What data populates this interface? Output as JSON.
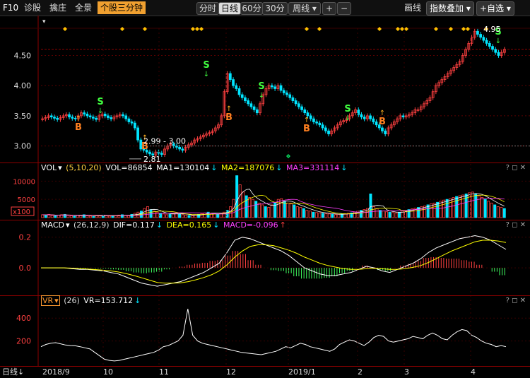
{
  "toolbar": {
    "f10": "F10",
    "diagnose": "诊股",
    "xiangqing": "擒庄",
    "quanjing": "全景",
    "mode": "个股三分钟",
    "periods": [
      "分时",
      "日线",
      "60分",
      "30分"
    ],
    "week_dd": "周线",
    "plus": "+",
    "minus": "−",
    "draw": "画线",
    "index_overlay": "指数叠加",
    "add_watch": "+自选"
  },
  "colors": {
    "up": "#ff4040",
    "down": "#00e5ff",
    "ma1": "#ffffff",
    "ma2": "#ffff00",
    "ma3": "#ff40ff",
    "grid": "#8b0000"
  },
  "chart_data": [
    {
      "type": "candlestick",
      "yticks": [
        "4.50",
        "4.00",
        "3.50",
        "3.00"
      ],
      "ylim": [
        2.75,
        4.95
      ],
      "annotations": {
        "range_label": "2.99 - 3.00",
        "low_label": "2.81",
        "high_label": "4.95",
        "s": "S",
        "b": "B"
      },
      "closes": [
        3.45,
        3.47,
        3.5,
        3.48,
        3.46,
        3.44,
        3.47,
        3.5,
        3.52,
        3.48,
        3.46,
        3.45,
        3.5,
        3.55,
        3.53,
        3.5,
        3.48,
        3.46,
        3.44,
        3.5,
        3.53,
        3.5,
        3.47,
        3.45,
        3.48,
        3.5,
        3.52,
        3.5,
        3.45,
        3.4,
        3.38,
        3.3,
        3.1,
        2.95,
        2.93,
        2.9,
        2.87,
        2.85,
        2.9,
        2.88,
        2.86,
        2.95,
        3.0,
        3.03,
        3.0,
        2.98,
        2.95,
        2.93,
        2.98,
        3.02,
        3.05,
        3.1,
        3.12,
        3.15,
        3.18,
        3.2,
        3.22,
        3.25,
        3.3,
        3.35,
        3.5,
        3.9,
        4.2,
        4.1,
        4.0,
        3.95,
        3.85,
        3.8,
        3.75,
        3.7,
        3.65,
        3.6,
        3.55,
        3.7,
        3.85,
        3.95,
        4.0,
        3.98,
        3.95,
        4.0,
        3.92,
        3.88,
        3.85,
        3.8,
        3.75,
        3.7,
        3.65,
        3.6,
        3.55,
        3.5,
        3.45,
        3.4,
        3.38,
        3.35,
        3.3,
        3.25,
        3.2,
        3.25,
        3.3,
        3.35,
        3.4,
        3.42,
        3.45,
        3.5,
        3.55,
        3.6,
        3.52,
        3.48,
        3.45,
        3.5,
        3.45,
        3.4,
        3.35,
        3.3,
        3.25,
        3.2,
        3.3,
        3.35,
        3.4,
        3.45,
        3.5,
        3.48,
        3.5,
        3.52,
        3.55,
        3.6,
        3.6,
        3.65,
        3.7,
        3.75,
        3.8,
        3.9,
        4.0,
        4.05,
        4.1,
        4.15,
        4.2,
        4.25,
        4.3,
        4.35,
        4.4,
        4.5,
        4.6,
        4.7,
        4.8,
        4.9,
        4.85,
        4.8,
        4.75,
        4.7,
        4.65,
        4.6,
        4.55,
        4.5,
        4.55,
        4.6
      ]
    },
    {
      "type": "bar",
      "name": "VOL",
      "params": "(5,10,20)",
      "readouts": {
        "vol": "VOL=86854",
        "ma1": "MA1=130104",
        "ma2": "MA2=187076",
        "ma3": "MA3=331114"
      },
      "yticks": [
        "10000",
        "5000"
      ],
      "unit": "x100",
      "ylim": [
        0,
        12000
      ],
      "values": [
        800,
        700,
        900,
        600,
        500,
        700,
        800,
        900,
        600,
        500,
        400,
        600,
        700,
        800,
        500,
        400,
        300,
        500,
        600,
        700,
        500,
        400,
        600,
        500,
        700,
        800,
        600,
        500,
        900,
        1200,
        1500,
        1800,
        2500,
        3000,
        2200,
        1800,
        1500,
        1200,
        1000,
        800,
        900,
        1100,
        1300,
        1000,
        800,
        700,
        600,
        500,
        700,
        900,
        1100,
        1300,
        1500,
        1200,
        1100,
        1000,
        1200,
        1500,
        2000,
        3000,
        5000,
        11500,
        9000,
        7000,
        6000,
        5500,
        5000,
        4500,
        4000,
        3500,
        3000,
        2800,
        3500,
        4000,
        5000,
        5200,
        4500,
        4000,
        3800,
        3500,
        3000,
        2800,
        2500,
        2000,
        1800,
        1500,
        1400,
        1300,
        1200,
        1100,
        1000,
        900,
        800,
        900,
        1000,
        1100,
        1200,
        1300,
        1500,
        1800,
        2000,
        2200,
        2500,
        6500,
        3000,
        2500,
        2000,
        1800,
        1600,
        1500,
        1400,
        1300,
        1500,
        1800,
        2000,
        2200,
        2400,
        2600,
        2800,
        3000,
        3200,
        3500,
        3800,
        4000,
        4200,
        4500,
        4800,
        5000,
        5200,
        5500,
        5800,
        6000,
        6200,
        6500,
        6800,
        7000,
        6500,
        6000,
        5500,
        5000,
        4500,
        4000,
        3500,
        3000,
        2800,
        2500
      ]
    },
    {
      "type": "bar",
      "name": "MACD",
      "params": "(26,12,9)",
      "readouts": {
        "dif": "DIF=0.117",
        "dea": "DEA=0.165",
        "macd": "MACD=-0.096"
      },
      "yticks": [
        "0.2",
        "0.0"
      ],
      "ylim": [
        -0.17,
        0.24
      ],
      "dif": [
        0.0,
        0.0,
        0.0,
        0.0,
        -0.005,
        -0.01,
        -0.01,
        -0.015,
        -0.02,
        -0.03,
        -0.04,
        -0.06,
        -0.08,
        -0.1,
        -0.11,
        -0.12,
        -0.11,
        -0.1,
        -0.09,
        -0.07,
        -0.05,
        -0.03,
        0.0,
        0.03,
        0.1,
        0.18,
        0.2,
        0.19,
        0.17,
        0.15,
        0.13,
        0.11,
        0.08,
        0.04,
        0.0,
        -0.02,
        -0.04,
        -0.05,
        -0.05,
        -0.04,
        -0.03,
        -0.01,
        0.01,
        0.0,
        -0.02,
        -0.03,
        -0.01,
        0.01,
        0.03,
        0.06,
        0.1,
        0.13,
        0.15,
        0.17,
        0.19,
        0.2,
        0.21,
        0.2,
        0.18,
        0.15,
        0.12
      ],
      "dea": [
        0.0,
        0.0,
        0.0,
        0.0,
        -0.002,
        -0.005,
        -0.008,
        -0.011,
        -0.015,
        -0.02,
        -0.027,
        -0.038,
        -0.05,
        -0.065,
        -0.08,
        -0.095,
        -0.1,
        -0.1,
        -0.098,
        -0.09,
        -0.078,
        -0.063,
        -0.045,
        -0.02,
        0.02,
        0.07,
        0.11,
        0.14,
        0.15,
        0.15,
        0.145,
        0.13,
        0.115,
        0.095,
        0.07,
        0.05,
        0.03,
        0.015,
        0.005,
        -0.005,
        -0.01,
        -0.01,
        -0.005,
        -0.003,
        -0.006,
        -0.01,
        -0.01,
        -0.005,
        0.003,
        0.015,
        0.035,
        0.06,
        0.085,
        0.11,
        0.13,
        0.15,
        0.17,
        0.18,
        0.18,
        0.175,
        0.165
      ],
      "macd": [
        0.0,
        0.0,
        0.0,
        0.0,
        -0.006,
        -0.01,
        -0.004,
        -0.008,
        -0.01,
        -0.02,
        -0.026,
        -0.044,
        -0.06,
        -0.07,
        -0.06,
        -0.05,
        -0.02,
        0.0,
        0.016,
        0.04,
        0.056,
        0.066,
        0.09,
        0.1,
        0.16,
        0.22,
        0.18,
        0.1,
        0.04,
        0.0,
        -0.03,
        -0.04,
        -0.07,
        -0.11,
        -0.14,
        -0.14,
        -0.14,
        -0.13,
        -0.11,
        -0.07,
        -0.04,
        0.0,
        0.03,
        0.006,
        -0.028,
        -0.04,
        0.0,
        0.03,
        0.054,
        0.09,
        0.13,
        0.14,
        0.13,
        0.12,
        0.12,
        0.1,
        0.08,
        0.04,
        0.0,
        -0.05,
        -0.096
      ]
    },
    {
      "type": "line",
      "name": "VR",
      "params": "(26)",
      "readouts": {
        "vr": "VR=153.712"
      },
      "yticks": [
        "400",
        "200"
      ],
      "ylim": [
        0,
        500
      ],
      "values": [
        150,
        170,
        180,
        185,
        175,
        165,
        160,
        158,
        150,
        140,
        130,
        100,
        70,
        40,
        30,
        25,
        30,
        40,
        50,
        60,
        70,
        80,
        90,
        100,
        120,
        150,
        160,
        180,
        200,
        250,
        480,
        250,
        200,
        180,
        170,
        160,
        150,
        140,
        130,
        120,
        110,
        100,
        95,
        90,
        85,
        80,
        90,
        100,
        110,
        130,
        150,
        140,
        160,
        180,
        170,
        150,
        140,
        130,
        120,
        110,
        130,
        170,
        190,
        210,
        200,
        180,
        160,
        190,
        230,
        250,
        240,
        200,
        190,
        200,
        210,
        220,
        240,
        230,
        220,
        250,
        270,
        250,
        220,
        210,
        250,
        280,
        300,
        290,
        250,
        230,
        200,
        180,
        170,
        150,
        160,
        150
      ]
    }
  ],
  "panels": {
    "vol_label": "VOL",
    "macd_label": "MACD",
    "vr_label": "VR",
    "ctrls": "? ◻ ✕"
  },
  "xaxis": {
    "mode": "日线",
    "labels": [
      "2018/9",
      "10",
      "11",
      "12",
      "2019/1",
      "2",
      "3",
      "4"
    ]
  }
}
